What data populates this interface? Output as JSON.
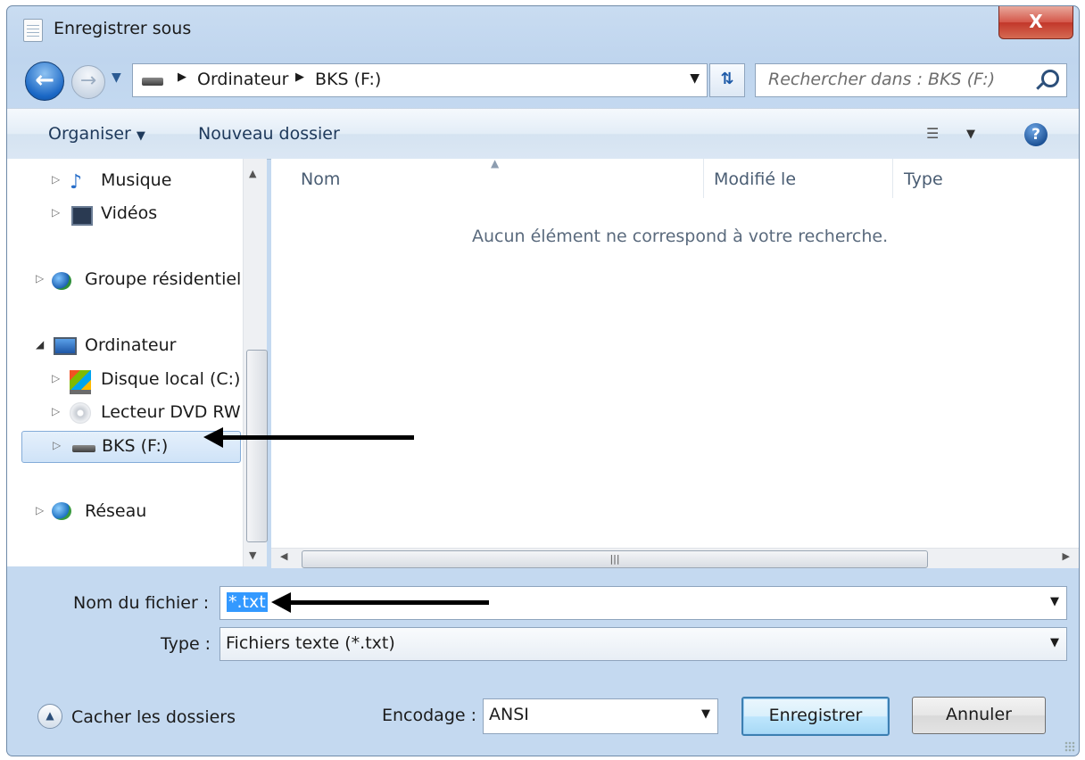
{
  "window": {
    "title": "Enregistrer sous",
    "close_label": "X"
  },
  "nav": {
    "breadcrumb": [
      "Ordinateur",
      "BKS (F:)"
    ],
    "search_placeholder": "Rechercher dans : BKS (F:)"
  },
  "toolbar": {
    "organize": "Organiser",
    "new_folder": "Nouveau dossier",
    "help": "?"
  },
  "sidebar": {
    "items": [
      {
        "label": "Musique",
        "icon": "music-icon"
      },
      {
        "label": "Vidéos",
        "icon": "video-icon"
      },
      {
        "label": "Groupe résidentiel",
        "icon": "homegroup-icon"
      },
      {
        "label": "Ordinateur",
        "icon": "computer-icon",
        "expanded": true
      },
      {
        "label": "Disque local (C:)",
        "icon": "local-disk-icon"
      },
      {
        "label": "Lecteur DVD RW",
        "icon": "dvd-icon"
      },
      {
        "label": "BKS (F:)",
        "icon": "drive-icon",
        "selected": true
      },
      {
        "label": "Réseau",
        "icon": "network-icon"
      }
    ]
  },
  "filelist": {
    "columns": [
      "Nom",
      "Modifié le",
      "Type"
    ],
    "empty_message": "Aucun élément ne correspond à votre recherche."
  },
  "form": {
    "filename_label": "Nom du fichier :",
    "filename_value": "*.txt",
    "type_label": "Type :",
    "type_value": "Fichiers texte (*.txt)"
  },
  "footer": {
    "hide_folders": "Cacher les dossiers",
    "encoding_label": "Encodage :",
    "encoding_value": "ANSI",
    "save_button": "Enregistrer",
    "cancel_button": "Annuler"
  },
  "colors": {
    "selection": "#3399ff",
    "accent": "#1a67c5",
    "annotation": "#000000"
  }
}
